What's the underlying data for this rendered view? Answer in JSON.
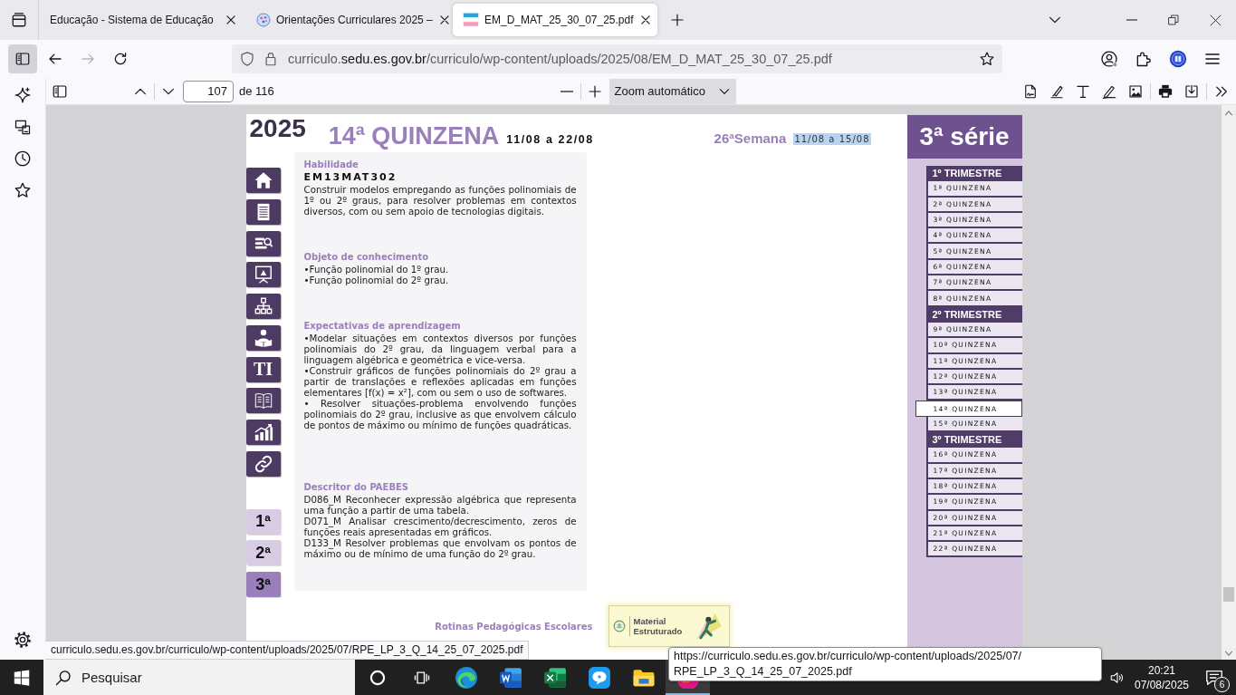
{
  "browser": {
    "tabs": [
      {
        "kind": "plain",
        "title": "Educação - Sistema de Educação",
        "selected": false
      },
      {
        "kind": "site",
        "title": "Orientações Curriculares 2025 –",
        "selected": false
      },
      {
        "kind": "pdf",
        "title": "EM_D_MAT_25_30_07_25.pdf",
        "selected": true
      }
    ],
    "sidebar_button": {
      "selected": true
    },
    "nav": {
      "back_disabled": false,
      "forward_disabled": true
    },
    "address": {
      "subdomain": "curriculo.",
      "domain": "sedu.es.gov.br",
      "path": "/curriculo/wp-content/uploads/2025/08/EM_D_MAT_25_30_07_25.pdf"
    },
    "status_link": "curriculo.sedu.es.gov.br/curriculo/wp-content/uploads/2025/07/RPE_LP_3_Q_14_25_07_2025.pdf",
    "tooltip": {
      "lines": [
        "https://curriculo.sedu.es.gov.br/curriculo/wp-content/uploads/2025/07/",
        "RPE_LP_3_Q_14_25_07_2025.pdf"
      ]
    }
  },
  "pdf_toolbar": {
    "page": "107",
    "page_count": "de 116",
    "zoom": "Zoom automático"
  },
  "page": {
    "year": "2025",
    "title": "14ª QUINZENA",
    "period": "11/08 a 22/08",
    "week": "26ªSemana",
    "week_period": {
      "text": "11/08 a 15/08",
      "selected": true
    },
    "tile_label": "TI",
    "grades": [
      {
        "label": "1ª",
        "selected": false
      },
      {
        "label": "2ª",
        "selected": false
      },
      {
        "label": "3ª",
        "selected": true
      }
    ],
    "sections": [
      {
        "heading": "Habilidade",
        "code": "EM13MAT302",
        "paragraphs": [
          "Construir modelos empregando as funções polinomiais de 1º ou 2º graus, para resolver problemas em contextos diversos, com ou sem apoio de tecnologias digitais."
        ]
      },
      {
        "heading": "Objeto de conhecimento",
        "paragraphs": [
          "•Função polinomial do 1º grau.",
          "•Função polinomial do 2º grau."
        ]
      },
      {
        "heading": "Expectativas de aprendizagem",
        "paragraphs": [
          "•Modelar situações em contextos diversos por funções polinomiais do 2º grau, da linguagem verbal para a linguagem algébrica e geométrica e vice-versa.",
          "•Construir gráficos de funções polinomiais do 2º grau a partir de translações e reflexões aplicadas em funções elementares [f(x) = x²], com ou sem o uso de softwares.",
          "• Resolver situações-problema envolvendo funções polinomiais do 2º grau, inclusive as que envolvem cálculo de pontos de máximo ou mínimo de funções quadráticas."
        ]
      },
      {
        "heading": "Descritor do PAEBES",
        "paragraphs": [
          "D086_M Reconhecer expressão algébrica que representa uma função a partir de uma tabela.",
          "D071_M Analisar crescimento/decrescimento, zeros de funções reais apresentadas em gráficos.",
          "D133_M Resolver problemas que envolvam os pontos de máximo ou de mínimo de uma função do 2º grau."
        ]
      }
    ],
    "series": "3ª série",
    "terms": [
      {
        "heading": "1º TRIMESTRE",
        "items": [
          {
            "label": "1ª QUINZENA",
            "selected": false
          },
          {
            "label": "2ª QUINZENA",
            "selected": false
          },
          {
            "label": "3ª QUINZENA",
            "selected": false
          },
          {
            "label": "4ª QUINZENA",
            "selected": false
          },
          {
            "label": "5ª QUINZENA",
            "selected": false
          },
          {
            "label": "6ª QUINZENA",
            "selected": false
          },
          {
            "label": "7ª QUINZENA",
            "selected": false
          },
          {
            "label": "8ª QUINZENA",
            "selected": false
          }
        ]
      },
      {
        "heading": "2º TRIMESTRE",
        "items": [
          {
            "label": "9ª QUINZENA",
            "selected": false
          },
          {
            "label": "10ª QUINZENA",
            "selected": false
          },
          {
            "label": "11ª QUINZENA",
            "selected": false
          },
          {
            "label": "12ª QUINZENA",
            "selected": false
          },
          {
            "label": "13ª QUINZENA",
            "selected": false
          },
          {
            "label": "14ª QUINZENA",
            "selected": true
          },
          {
            "label": "15ª QUINZENA",
            "selected": false
          }
        ]
      },
      {
        "heading": "3º TRIMESTRE",
        "items": [
          {
            "label": "16ª QUINZENA",
            "selected": false
          },
          {
            "label": "17ª QUINZENA",
            "selected": false
          },
          {
            "label": "18ª QUINZENA",
            "selected": false
          },
          {
            "label": "19ª QUINZENA",
            "selected": false
          },
          {
            "label": "20ª QUINZENA",
            "selected": false
          },
          {
            "label": "21ª QUINZENA",
            "selected": false
          },
          {
            "label": "22ª QUINZENA",
            "selected": false
          }
        ]
      }
    ],
    "footer_label": "Rotinas Pedagógicas Escolares",
    "thumbnail": {
      "title": "Material Estruturado"
    }
  },
  "taskbar": {
    "search_placeholder": "Pesquisar",
    "time": "20:21",
    "date": "07/08/2025",
    "notifications": "6"
  }
}
